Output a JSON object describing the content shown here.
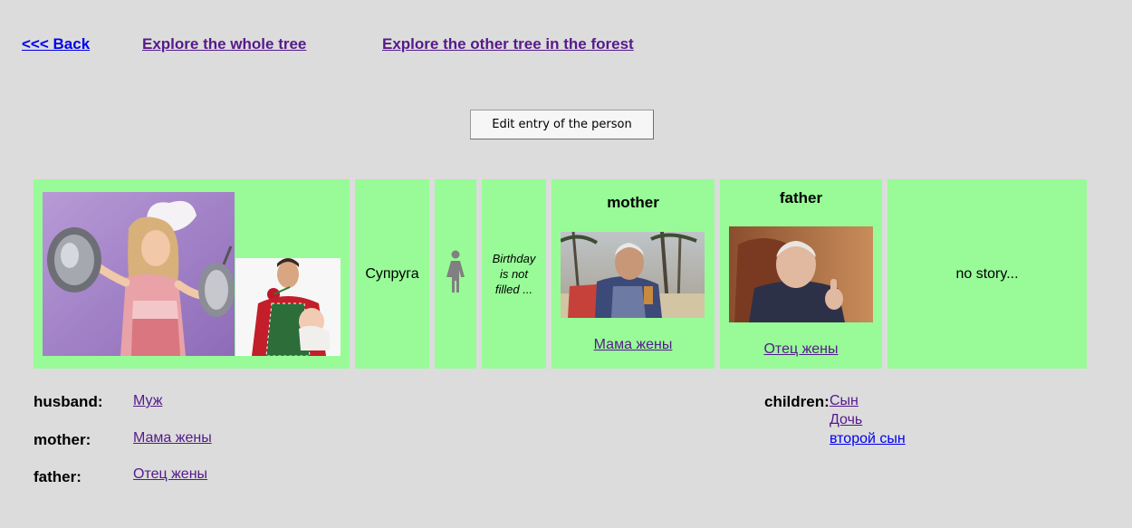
{
  "nav": {
    "back": "<<< Back",
    "explore_whole": "Explore the whole tree",
    "explore_other": "Explore the other tree in the forest"
  },
  "edit_button": "Edit entry of the person",
  "person": {
    "relation": "Супруга",
    "gender_icon": "female-icon",
    "birthday": "Birthday is not filled ...",
    "story": "no story..."
  },
  "parents": {
    "mother": {
      "title": "mother",
      "link": "Мама жены"
    },
    "father": {
      "title": "father",
      "link": "Отец жены"
    }
  },
  "relations": [
    {
      "label": "husband:",
      "value": "Муж"
    },
    {
      "label": "mother:",
      "value": "Мама жены"
    },
    {
      "label": "father:",
      "value": "Отец жены"
    }
  ],
  "children": {
    "label": "children:",
    "items": [
      "Сын",
      "Дочь",
      "второй сын"
    ]
  },
  "colors": {
    "background": "#dcdcdc",
    "cell": "#98fb98",
    "link_unvisited": "#0000ee",
    "link_visited": "#551a8b"
  }
}
